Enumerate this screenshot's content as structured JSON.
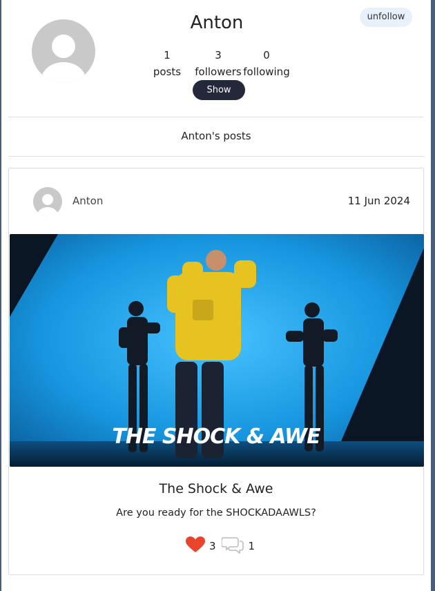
{
  "profile": {
    "name": "Anton",
    "unfollow_label": "unfollow",
    "stats": {
      "posts_count": "1",
      "posts_label": "posts",
      "followers_count": "3",
      "followers_label": "followers",
      "following_count": "0",
      "following_label": "following"
    },
    "show_label": "Show"
  },
  "posts_heading": "Anton's posts",
  "post": {
    "author": "Anton",
    "date": "11 Jun 2024",
    "image_caption": "THE SHOCK & AWE",
    "title": "The Shock & Awe",
    "text": "Are you ready for the SHOCKADAAWLS?",
    "likes": "3",
    "comments": "1"
  },
  "colors": {
    "accent_dark": "#23283a",
    "unfollow_bg": "#e6f1fb",
    "heart": "#e8452c",
    "image_bg": "#1aa3e8"
  }
}
